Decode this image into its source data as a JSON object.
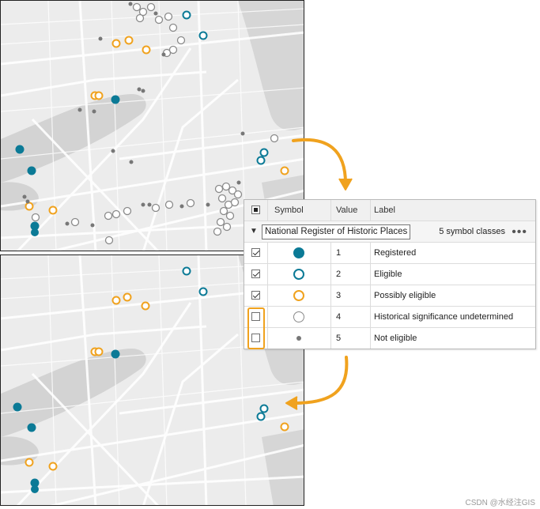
{
  "table": {
    "headers": {
      "symbol": "Symbol",
      "value": "Value",
      "label": "Label"
    },
    "group": {
      "field": "National Register of Historic Places",
      "count": "5 symbol classes",
      "more": "•••"
    },
    "classes": [
      {
        "symbol": "filled-teal-circle-icon",
        "value": "1",
        "label": "Registered",
        "checked": true
      },
      {
        "symbol": "teal-ring-icon",
        "value": "2",
        "label": "Eligible",
        "checked": true
      },
      {
        "symbol": "orange-ring-icon",
        "value": "3",
        "label": "Possibly eligible",
        "checked": true
      },
      {
        "symbol": "grey-ring-icon",
        "value": "4",
        "label": "Historical significance undetermined",
        "checked": false
      },
      {
        "symbol": "grey-dot-icon",
        "value": "5",
        "label": "Not eligible",
        "checked": false
      }
    ]
  },
  "colors": {
    "registered": "#0b7a96",
    "possibly_eligible": "#f0a21e",
    "undetermined": "#8a8a8a",
    "not_eligible": "#777777",
    "highlight": "#f0a21e"
  },
  "watermark": "CSDN @水经注GIS"
}
